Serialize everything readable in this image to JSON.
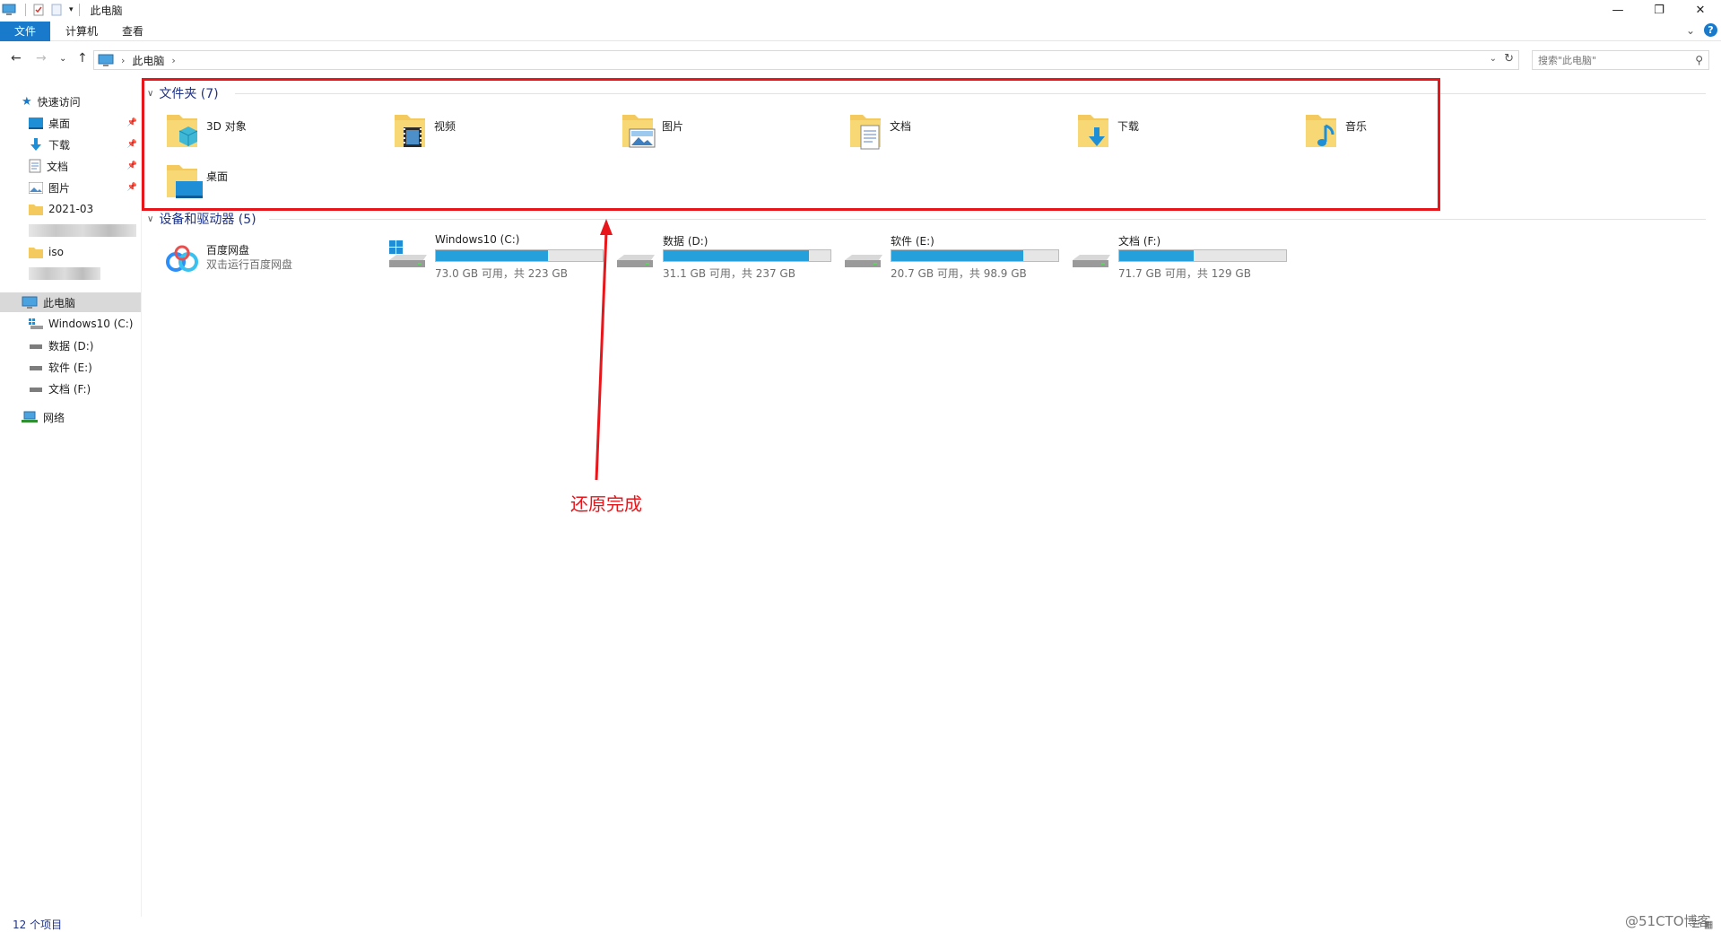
{
  "window": {
    "title": "此电脑",
    "controls": {
      "minimize": "—",
      "restore": "❐",
      "close": "✕"
    }
  },
  "ribbon": {
    "tabs": [
      "文件",
      "计算机",
      "查看"
    ],
    "expand": "⌄",
    "help": "?"
  },
  "nav": {
    "back": "←",
    "forward": "→",
    "recent": "⌄",
    "up": "↑",
    "address": "此电脑",
    "search_placeholder": "搜索\"此电脑\""
  },
  "sidebar": {
    "quick_access": "快速访问",
    "quick_items": [
      {
        "label": "桌面",
        "icon": "desktop-icon",
        "pinned": true
      },
      {
        "label": "下载",
        "icon": "download-icon",
        "pinned": true
      },
      {
        "label": "文档",
        "icon": "document-icon",
        "pinned": true
      },
      {
        "label": "图片",
        "icon": "picture-icon",
        "pinned": true
      },
      {
        "label": "2021-03",
        "icon": "folder-icon",
        "pinned": false
      },
      {
        "label": "iso",
        "icon": "folder-icon",
        "pinned": false
      }
    ],
    "this_pc": "此电脑",
    "drives": [
      "Windows10 (C:)",
      "数据 (D:)",
      "软件 (E:)",
      "文档 (F:)"
    ],
    "network": "网络"
  },
  "folders": {
    "header": "文件夹 (7)",
    "items": [
      {
        "name": "3D 对象",
        "icon": "3d-objects-icon"
      },
      {
        "name": "视频",
        "icon": "video-icon"
      },
      {
        "name": "图片",
        "icon": "picture-icon"
      },
      {
        "name": "文档",
        "icon": "document-icon"
      },
      {
        "name": "下载",
        "icon": "download-icon"
      },
      {
        "name": "音乐",
        "icon": "music-icon"
      },
      {
        "name": "桌面",
        "icon": "desktop-icon"
      }
    ]
  },
  "devices": {
    "header": "设备和驱动器 (5)",
    "baidu": {
      "name": "百度网盘",
      "subtitle": "双击运行百度网盘"
    },
    "drives": [
      {
        "name": "Windows10 (C:)",
        "free": "73.0 GB 可用，共 223 GB",
        "used_fraction": 0.673,
        "system": true
      },
      {
        "name": "数据 (D:)",
        "free": "31.1 GB 可用，共 237 GB",
        "used_fraction": 0.869,
        "system": false
      },
      {
        "name": "软件 (E:)",
        "free": "20.7 GB 可用，共 98.9 GB",
        "used_fraction": 0.791,
        "system": false
      },
      {
        "name": "文档 (F:)",
        "free": "71.7 GB 可用，共 129 GB",
        "used_fraction": 0.444,
        "system": false
      }
    ]
  },
  "annotation": {
    "text": "还原完成",
    "color": "#e8161b"
  },
  "status": {
    "count": "12 个项目"
  },
  "watermark": "@51CTO博客",
  "colors": {
    "accent": "#1979ca",
    "bar_fill": "#26a0da",
    "group_header": "#1e3287"
  }
}
